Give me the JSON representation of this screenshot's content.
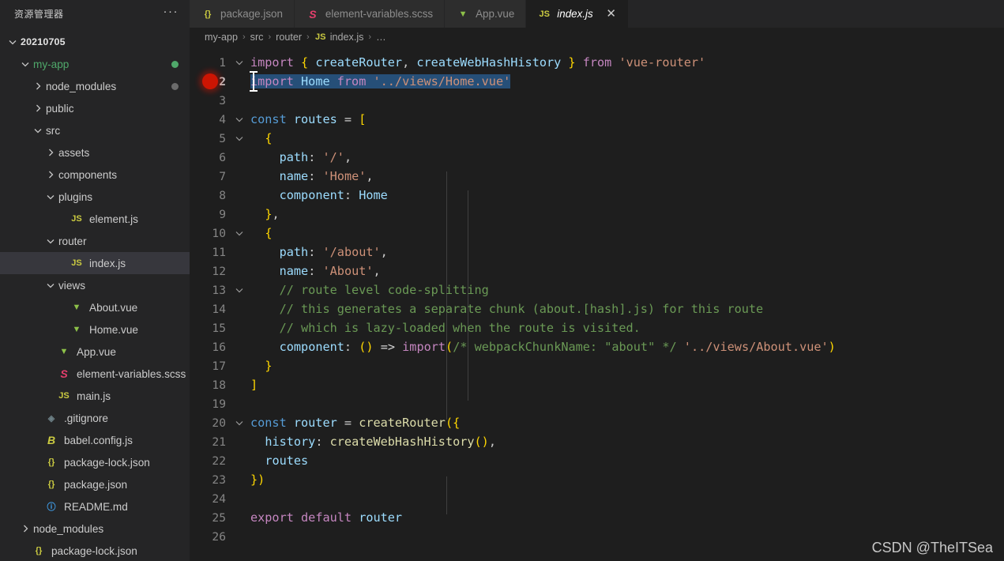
{
  "sidebar": {
    "header_title": "资源管理器",
    "more_actions": "···",
    "tree": [
      {
        "label": "20210705",
        "depth": 0,
        "twisty": "down",
        "icon": "",
        "root": true
      },
      {
        "label": "my-app",
        "depth": 1,
        "twisty": "down",
        "icon": "",
        "folder_color": "#4fa86a",
        "badge": "green"
      },
      {
        "label": "node_modules",
        "depth": 2,
        "twisty": "right",
        "icon": "",
        "badge": "gray"
      },
      {
        "label": "public",
        "depth": 2,
        "twisty": "right",
        "icon": ""
      },
      {
        "label": "src",
        "depth": 2,
        "twisty": "down",
        "icon": ""
      },
      {
        "label": "assets",
        "depth": 3,
        "twisty": "right",
        "icon": ""
      },
      {
        "label": "components",
        "depth": 3,
        "twisty": "right",
        "icon": ""
      },
      {
        "label": "plugins",
        "depth": 3,
        "twisty": "down",
        "icon": ""
      },
      {
        "label": "element.js",
        "depth": 4,
        "twisty": "none",
        "icon": "js"
      },
      {
        "label": "router",
        "depth": 3,
        "twisty": "down",
        "icon": ""
      },
      {
        "label": "index.js",
        "depth": 4,
        "twisty": "none",
        "icon": "js",
        "selected": true
      },
      {
        "label": "views",
        "depth": 3,
        "twisty": "down",
        "icon": ""
      },
      {
        "label": "About.vue",
        "depth": 4,
        "twisty": "none",
        "icon": "vue"
      },
      {
        "label": "Home.vue",
        "depth": 4,
        "twisty": "none",
        "icon": "vue"
      },
      {
        "label": "App.vue",
        "depth": 3,
        "twisty": "none",
        "icon": "vue"
      },
      {
        "label": "element-variables.scss",
        "depth": 3,
        "twisty": "none",
        "icon": "scss"
      },
      {
        "label": "main.js",
        "depth": 3,
        "twisty": "none",
        "icon": "js"
      },
      {
        "label": ".gitignore",
        "depth": 2,
        "twisty": "none",
        "icon": "git"
      },
      {
        "label": "babel.config.js",
        "depth": 2,
        "twisty": "none",
        "icon": "babel"
      },
      {
        "label": "package-lock.json",
        "depth": 2,
        "twisty": "none",
        "icon": "json"
      },
      {
        "label": "package.json",
        "depth": 2,
        "twisty": "none",
        "icon": "json"
      },
      {
        "label": "README.md",
        "depth": 2,
        "twisty": "none",
        "icon": "md"
      },
      {
        "label": "node_modules",
        "depth": 1,
        "twisty": "right",
        "icon": ""
      },
      {
        "label": "package-lock.json",
        "depth": 1,
        "twisty": "none",
        "icon": "json"
      }
    ]
  },
  "tabs": [
    {
      "label": "package.json",
      "icon": "json",
      "active": false
    },
    {
      "label": "element-variables.scss",
      "icon": "scss",
      "active": false
    },
    {
      "label": "App.vue",
      "icon": "vue",
      "active": false
    },
    {
      "label": "index.js",
      "icon": "js",
      "active": true,
      "close": "✕"
    }
  ],
  "breadcrumb": {
    "items": [
      "my-app",
      "src",
      "router",
      "index.js",
      "…"
    ],
    "separator": "›",
    "file_icon": "js"
  },
  "editor": {
    "language": "javascript",
    "selected_line": 2,
    "breakpoint_line": 2,
    "lines": [
      {
        "n": 1,
        "fold": "down"
      },
      {
        "n": 2,
        "fold": "none"
      },
      {
        "n": 3,
        "fold": "none"
      },
      {
        "n": 4,
        "fold": "down"
      },
      {
        "n": 5,
        "fold": "down"
      },
      {
        "n": 6,
        "fold": "none"
      },
      {
        "n": 7,
        "fold": "none"
      },
      {
        "n": 8,
        "fold": "none"
      },
      {
        "n": 9,
        "fold": "none"
      },
      {
        "n": 10,
        "fold": "down"
      },
      {
        "n": 11,
        "fold": "none"
      },
      {
        "n": 12,
        "fold": "none"
      },
      {
        "n": 13,
        "fold": "down"
      },
      {
        "n": 14,
        "fold": "none"
      },
      {
        "n": 15,
        "fold": "none"
      },
      {
        "n": 16,
        "fold": "none"
      },
      {
        "n": 17,
        "fold": "none"
      },
      {
        "n": 18,
        "fold": "none"
      },
      {
        "n": 19,
        "fold": "none"
      },
      {
        "n": 20,
        "fold": "down"
      },
      {
        "n": 21,
        "fold": "none"
      },
      {
        "n": 22,
        "fold": "none"
      },
      {
        "n": 23,
        "fold": "none"
      },
      {
        "n": 24,
        "fold": "none"
      },
      {
        "n": 25,
        "fold": "none"
      },
      {
        "n": 26,
        "fold": "none"
      }
    ],
    "source": [
      "import { createRouter, createWebHashHistory } from 'vue-router'",
      "import Home from '../views/Home.vue'",
      "",
      "const routes = [",
      "  {",
      "    path: '/',",
      "    name: 'Home',",
      "    component: Home",
      "  },",
      "  {",
      "    path: '/about',",
      "    name: 'About',",
      "    // route level code-splitting",
      "    // this generates a separate chunk (about.[hash].js) for this route",
      "    // which is lazy-loaded when the route is visited.",
      "    component: () => import(/* webpackChunkName: \"about\" */ '../views/About.vue')",
      "  }",
      "]",
      "",
      "const router = createRouter({",
      "  history: createWebHashHistory(),",
      "  routes",
      "})",
      "",
      "export default router",
      ""
    ]
  },
  "watermark": "CSDN @TheITSea",
  "colors": {
    "background": "#1e1e1e",
    "sidebar_bg": "#252526",
    "tab_inactive_bg": "#2d2d2d",
    "selection_blue": "#264f78",
    "breakpoint_red": "#e51400",
    "git_modified_green": "#4fa86a",
    "row_selected": "#37373d"
  }
}
